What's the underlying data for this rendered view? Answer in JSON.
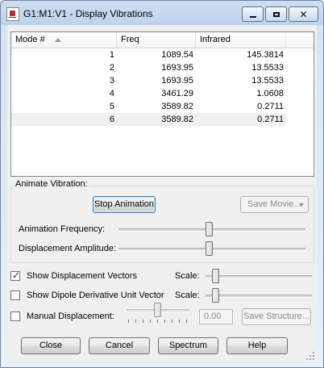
{
  "window": {
    "title": "G1:M1:V1 - Display Vibrations",
    "minimize_label": "",
    "maximize_label": "",
    "close_glyph": "✕"
  },
  "table": {
    "columns": [
      "Mode #",
      "Freq",
      "Infrared"
    ],
    "rows": [
      {
        "mode": "1",
        "freq": "1089.54",
        "ir": "145.3814"
      },
      {
        "mode": "2",
        "freq": "1693.95",
        "ir": "13.5533"
      },
      {
        "mode": "3",
        "freq": "1693.95",
        "ir": "13.5533"
      },
      {
        "mode": "4",
        "freq": "3461.29",
        "ir": "1.0608"
      },
      {
        "mode": "5",
        "freq": "3589.82",
        "ir": "0.2711"
      },
      {
        "mode": "6",
        "freq": "3589.82",
        "ir": "0.2711"
      }
    ],
    "selected_mode": "6"
  },
  "animate": {
    "group_label": "Animate Vibration:",
    "stop_button": "Stop Animation",
    "save_movie_button": "Save Movie...",
    "frequency_label": "Animation Frequency:",
    "frequency_level": 0.5,
    "amplitude_label": "Displacement Amplitude:",
    "amplitude_level": 0.5
  },
  "options": {
    "show_vectors_label": "Show Displacement Vectors",
    "show_vectors_checked": true,
    "show_dipole_label": "Show Dipole Derivative Unit Vector",
    "show_dipole_checked": false,
    "scale_label": "Scale:",
    "manual_label": "Manual Displacement:",
    "manual_checked": false,
    "manual_value": "0.00",
    "save_structure_button": "Save Structure..."
  },
  "footer": {
    "close_button": "Close",
    "cancel_button": "Cancel",
    "spectrum_button": "Spectrum",
    "help_button": "Help"
  }
}
